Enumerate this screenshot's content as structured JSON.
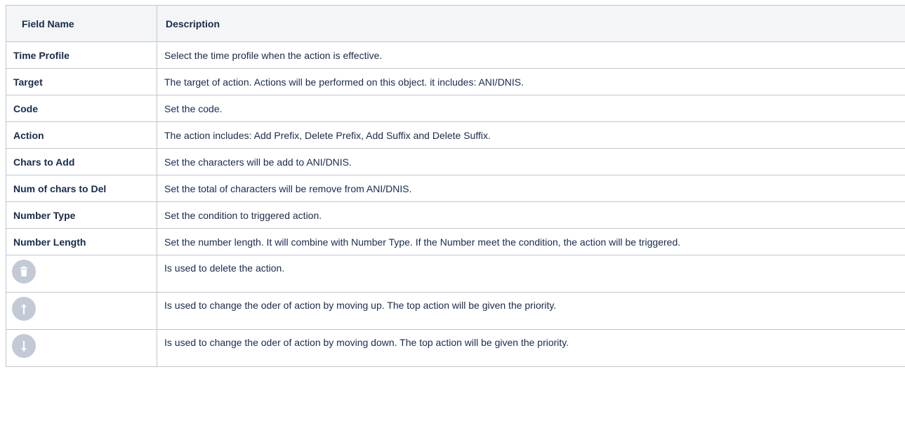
{
  "table": {
    "headers": {
      "field_name": "Field Name",
      "description": "Description"
    },
    "rows": [
      {
        "field": "Time Profile",
        "description": "Select the time profile when the action is effective."
      },
      {
        "field": "Target",
        "description": "The target of action. Actions will be performed on this object. it includes: ANI/DNIS."
      },
      {
        "field": "Code",
        "description": "Set the code."
      },
      {
        "field": "Action",
        "description": "The action includes: Add Prefix, Delete Prefix, Add Suffix and Delete Suffix."
      },
      {
        "field": "Chars to Add",
        "description": "Set the characters will be add to ANI/DNIS."
      },
      {
        "field": "Num of chars to Del",
        "description": "Set the total of characters will be remove from ANI/DNIS."
      },
      {
        "field": "Number Type",
        "description": "Set the condition to triggered action."
      },
      {
        "field": "Number Length",
        "description": "Set the number length. It will combine with Number Type. If the Number meet the condition, the action will be triggered."
      }
    ],
    "icon_rows": [
      {
        "icon": "delete-icon",
        "description": "Is used to delete the action."
      },
      {
        "icon": "arrow-up-icon",
        "description": "Is used to change the oder of action by moving up. The top action will be given the priority."
      },
      {
        "icon": "arrow-down-icon",
        "description": "Is used to change the oder of action by moving down. The top action will be given the priority."
      }
    ]
  },
  "colors": {
    "header_bg": "#f4f5f7",
    "border": "#c1c7d0",
    "icon_bg": "#c3cad5"
  }
}
